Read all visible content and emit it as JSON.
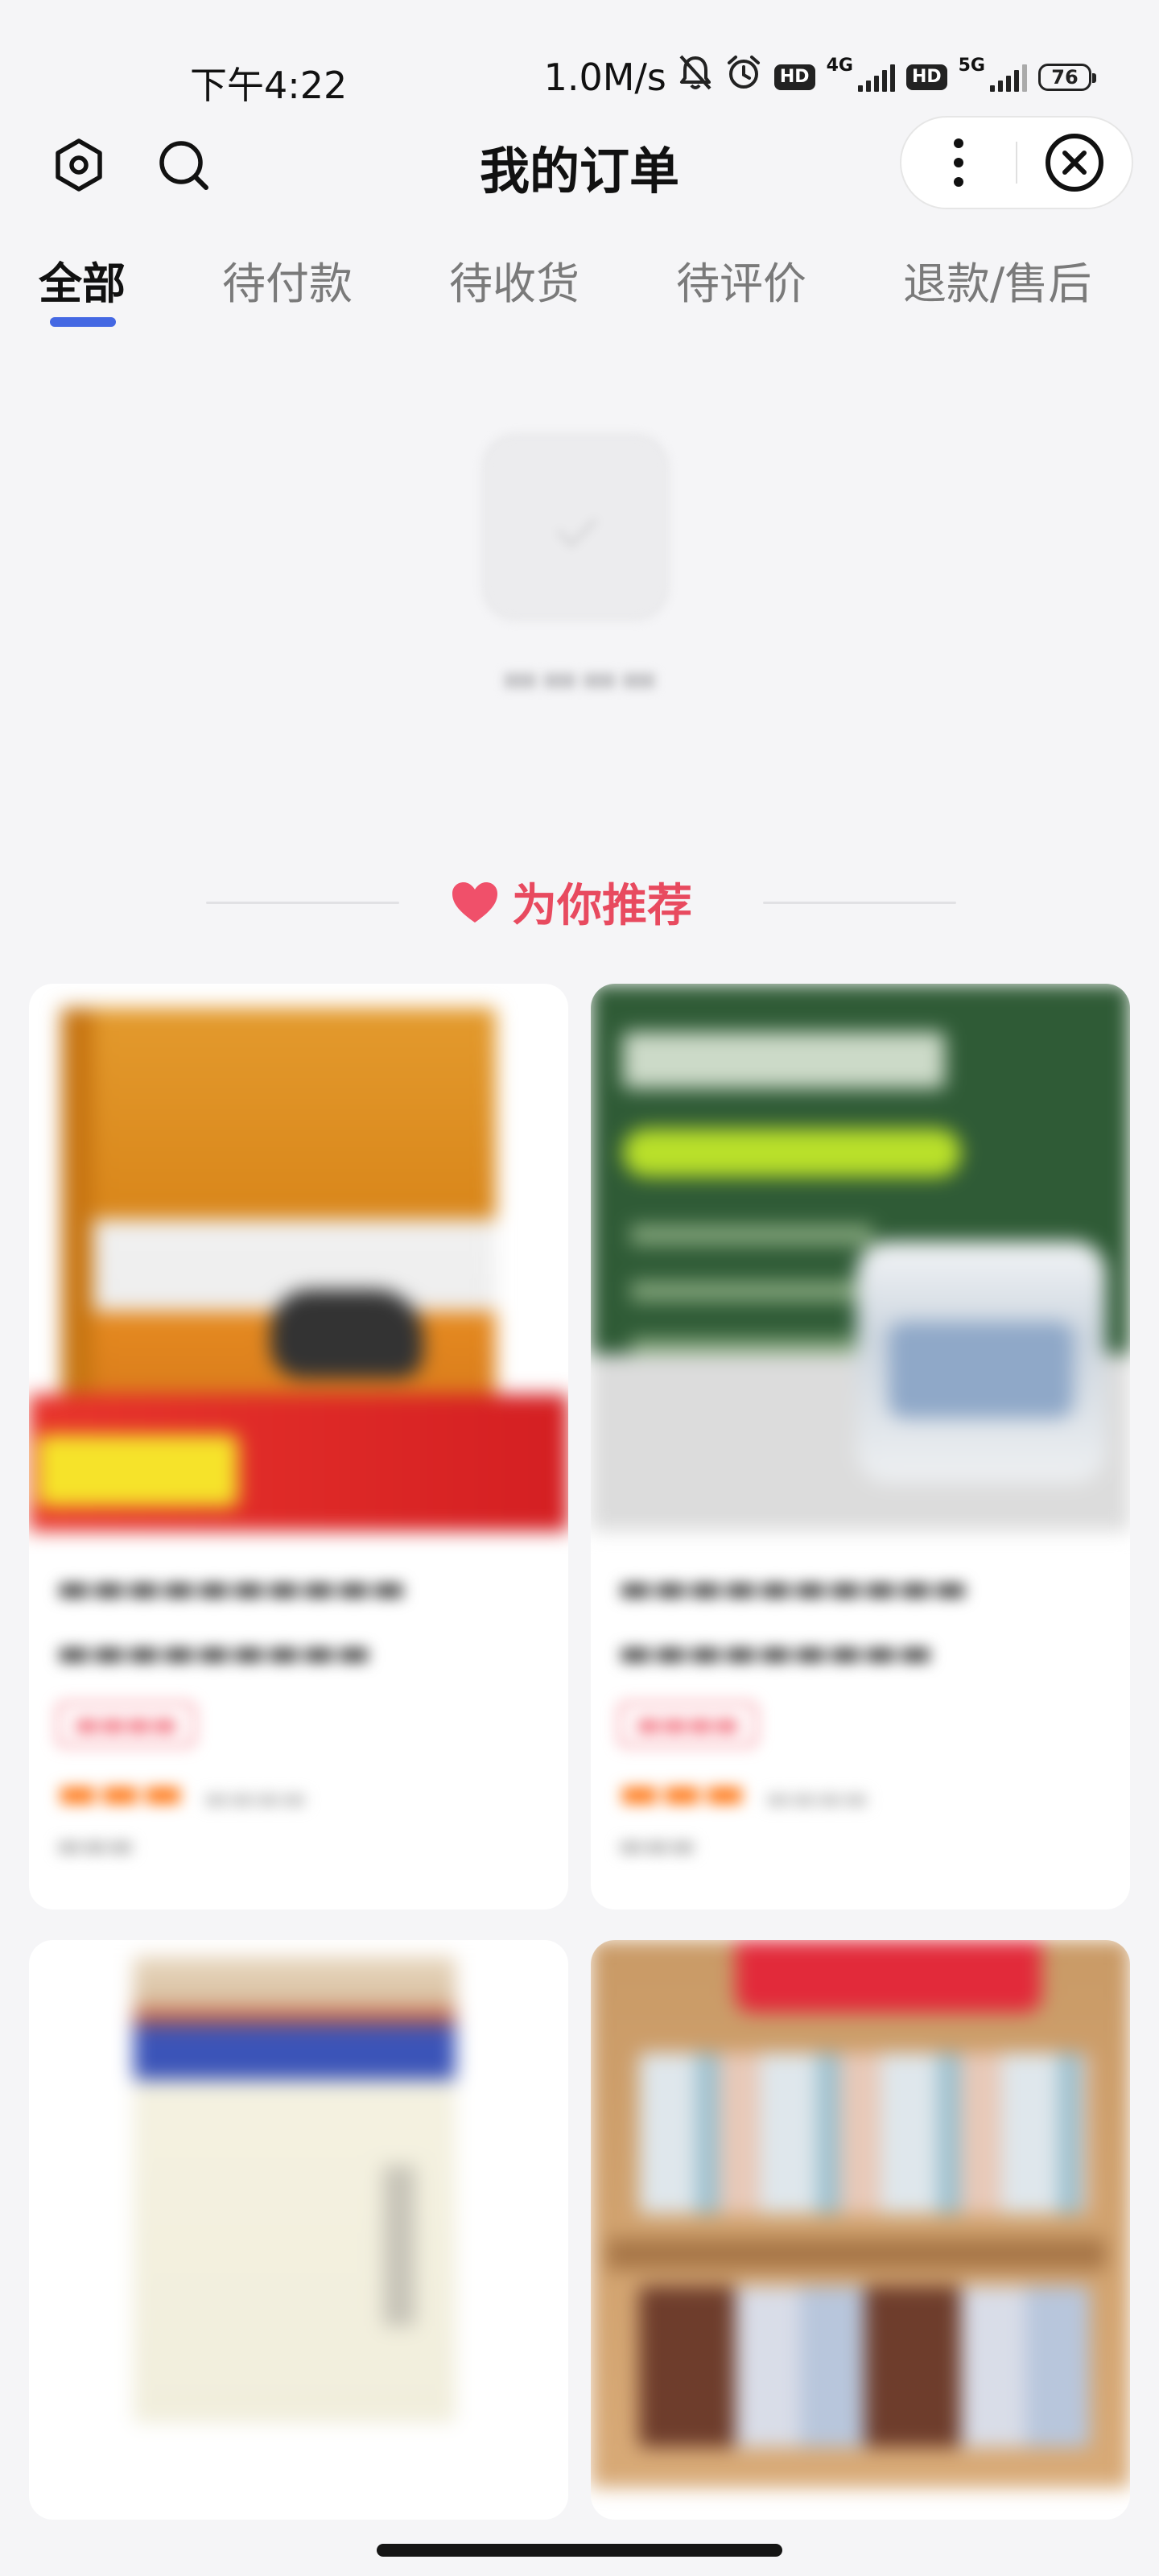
{
  "status_bar": {
    "time": "下午4:22",
    "network_speed": "1.0M/s",
    "sim1_type": "4G",
    "sim2_type": "5G",
    "hd_label": "HD",
    "battery": "76"
  },
  "header": {
    "title": "我的订单"
  },
  "tabs": [
    {
      "label": "全部",
      "active": true
    },
    {
      "label": "待付款",
      "active": false
    },
    {
      "label": "待收货",
      "active": false
    },
    {
      "label": "待评价",
      "active": false
    },
    {
      "label": "退款/售后",
      "active": false
    }
  ],
  "recommendation": {
    "title": "为你推荐"
  },
  "icons": {
    "settings": "settings-icon",
    "search": "search-icon",
    "more": "more-vertical-icon",
    "close": "close-circle-icon",
    "heart": "heart-icon"
  },
  "colors": {
    "accent_blue": "#4468e3",
    "recommend_red": "#e84a5f",
    "price_orange": "#ff7a1a"
  }
}
